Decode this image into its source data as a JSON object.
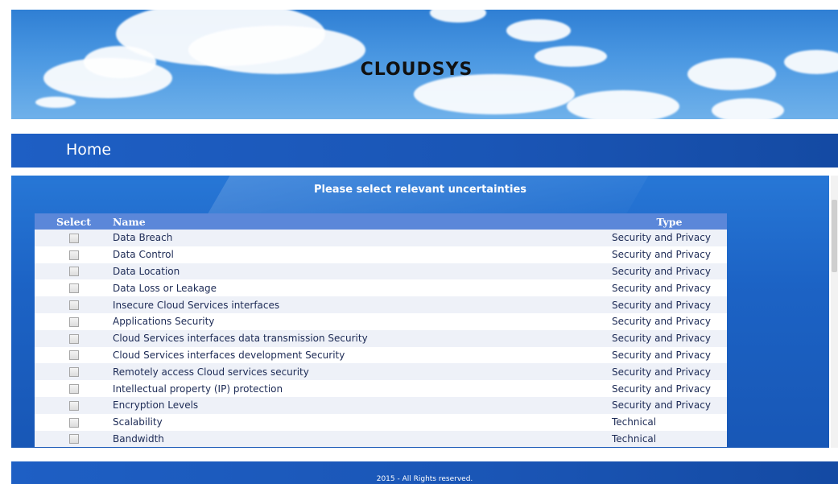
{
  "header": {
    "title": "CLOUDSYS"
  },
  "nav": {
    "home": "Home"
  },
  "panel": {
    "title": "Please select relevant uncertainties"
  },
  "table": {
    "headers": {
      "select": "Select",
      "name": "Name",
      "type": "Type"
    },
    "rows": [
      {
        "name": "Data Breach",
        "type": "Security and Privacy",
        "selected": false
      },
      {
        "name": "Data Control",
        "type": "Security and Privacy",
        "selected": false
      },
      {
        "name": "Data Location",
        "type": "Security and Privacy",
        "selected": false
      },
      {
        "name": "Data Loss or Leakage",
        "type": "Security and Privacy",
        "selected": false
      },
      {
        "name": "Insecure Cloud Services interfaces",
        "type": "Security and Privacy",
        "selected": false
      },
      {
        "name": "Applications Security",
        "type": "Security and Privacy",
        "selected": false
      },
      {
        "name": "Cloud Services interfaces data transmission Security",
        "type": "Security and Privacy",
        "selected": false
      },
      {
        "name": "Cloud Services interfaces development Security",
        "type": "Security and Privacy",
        "selected": false
      },
      {
        "name": "Remotely access Cloud services security",
        "type": "Security and Privacy",
        "selected": false
      },
      {
        "name": "Intellectual property (IP) protection",
        "type": "Security and Privacy",
        "selected": false
      },
      {
        "name": "Encryption Levels",
        "type": "Security and Privacy",
        "selected": false
      },
      {
        "name": "Scalability",
        "type": "Technical",
        "selected": false
      },
      {
        "name": "Bandwidth",
        "type": "Technical",
        "selected": false
      }
    ]
  },
  "footer": {
    "text": "2015 - All Rights reserved."
  }
}
